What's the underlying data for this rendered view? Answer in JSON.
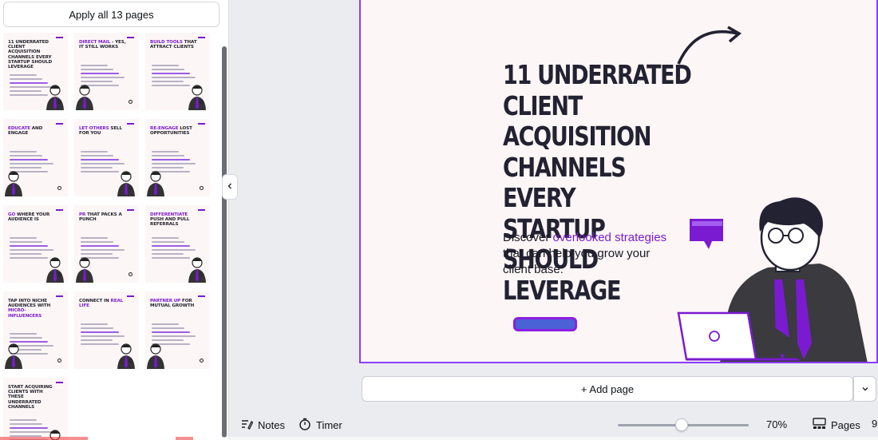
{
  "left_panel": {
    "apply_all_label": "Apply all 13 pages",
    "pages": [
      {
        "title": "11 UNDERRATED CLIENT ACQUISITION CHANNELS EVERY STARTUP SHOULD LEVERAGE",
        "highlight": ""
      },
      {
        "title": "DIRECT MAIL - YES, IT STILL WORKS",
        "highlight": "DIRECT MAIL"
      },
      {
        "title": "BUILD TOOLS THAT ATTRACT CLIENTS",
        "highlight": "BUILD TOOLS"
      },
      {
        "title": "EDUCATE AND ENGAGE",
        "highlight": "EDUCATE"
      },
      {
        "title": "LET OTHERS SELL FOR YOU",
        "highlight": "LET OTHERS"
      },
      {
        "title": "RE-ENGAGE LOST OPPORTUNITIES",
        "highlight": "RE-ENGAGE"
      },
      {
        "title": "GO WHERE YOUR AUDIENCE IS",
        "highlight": "GO"
      },
      {
        "title": "PR THAT PACKS A PUNCH",
        "highlight": "PR"
      },
      {
        "title": "DIFFERENTIATE PUSH AND PULL REFERRALS",
        "highlight": "DIFFERENTIATE"
      },
      {
        "title": "TAP INTO NICHE AUDIENCES WITH MICRO-INFLUENCERS",
        "highlight": "MICRO-INFLUENCERS"
      },
      {
        "title": "CONNECT IN REAL LIFE",
        "highlight": "REAL LIFE"
      },
      {
        "title": "PARTNER UP FOR MUTUAL GROWTH",
        "highlight": "PARTNER UP"
      },
      {
        "title": "START ACQUIRING CLIENTS WITH THESE UNDERRATED CHANNELS",
        "highlight": ""
      }
    ]
  },
  "slide": {
    "title_lines": [
      "11 UNDERRATED",
      "CLIENT ACQUISITION",
      "CHANNELS EVERY",
      "STARTUP SHOULD",
      "LEVERAGE"
    ],
    "subtitle_pre": "Discover ",
    "subtitle_hl": "overlooked strategies",
    "subtitle_post": " that can help you grow your client base."
  },
  "add_page_label": "+ Add page",
  "footer": {
    "notes_label": "Notes",
    "timer_label": "Timer",
    "zoom_value": "70%",
    "zoom_fraction": 0.49,
    "pages_label": "Pages",
    "page_count": "9"
  },
  "colors": {
    "accent": "#8b3dff",
    "brand_purple": "#7a1bd1",
    "slide_bg": "#fdf6f6",
    "text_dark": "#232232"
  },
  "icons": {
    "collapse": "chevron-left-icon",
    "notes": "notes-icon",
    "timer": "timer-icon",
    "pages": "pages-grid-icon",
    "add_page_more": "chevron-down-icon"
  }
}
